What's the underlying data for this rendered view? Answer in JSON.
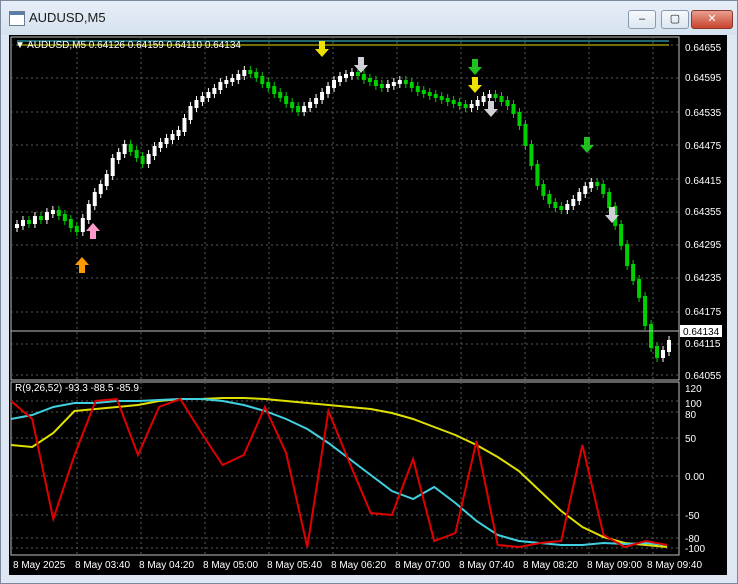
{
  "window": {
    "title": "AUDUSD,M5",
    "buttons": {
      "minimize": "‒",
      "maximize": "▢",
      "close": "✕"
    }
  },
  "main_chart": {
    "header": "▼ AUDUSD,M5  0.64126 0.64159 0.64110 0.64134",
    "price_labels": [
      "0.64655",
      "0.64595",
      "0.64535",
      "0.64475",
      "0.64415",
      "0.64355",
      "0.64295",
      "0.64235",
      "0.64175",
      "0.64115",
      "0.64055"
    ],
    "current_price": "0.64134",
    "colors": {
      "up_candle": "#ffffff",
      "down_candle": "#00d000",
      "ma_fast": "#40d0e0",
      "ma_slow": "#e0e000",
      "bid_line": "#c0c0c0"
    }
  },
  "indicator": {
    "header": "R(9,26,52) -93.3 -88.5 -85.9",
    "labels": [
      "120",
      "100",
      "80",
      "50",
      "0.00",
      "-50",
      "-80",
      "-100"
    ],
    "colors": {
      "r9": "#e00000",
      "r26": "#40d0e0",
      "r52": "#e0e000"
    }
  },
  "time_axis": [
    "8 May 2025",
    "8 May 03:40",
    "8 May 04:20",
    "8 May 05:00",
    "8 May 05:40",
    "8 May 06:20",
    "8 May 07:00",
    "8 May 07:40",
    "8 May 08:20",
    "8 May 09:00",
    "8 May 09:40"
  ],
  "signals": [
    {
      "name": "buy-arrow-orange",
      "color": "#ff9900"
    },
    {
      "name": "buy-arrow-pink",
      "color": "#ff99cc"
    },
    {
      "name": "sell-arrow-yellow",
      "color": "#f0e000"
    },
    {
      "name": "sell-arrow-white",
      "color": "#d0d0d8"
    },
    {
      "name": "sell-arrow-green",
      "color": "#20c020"
    }
  ]
}
